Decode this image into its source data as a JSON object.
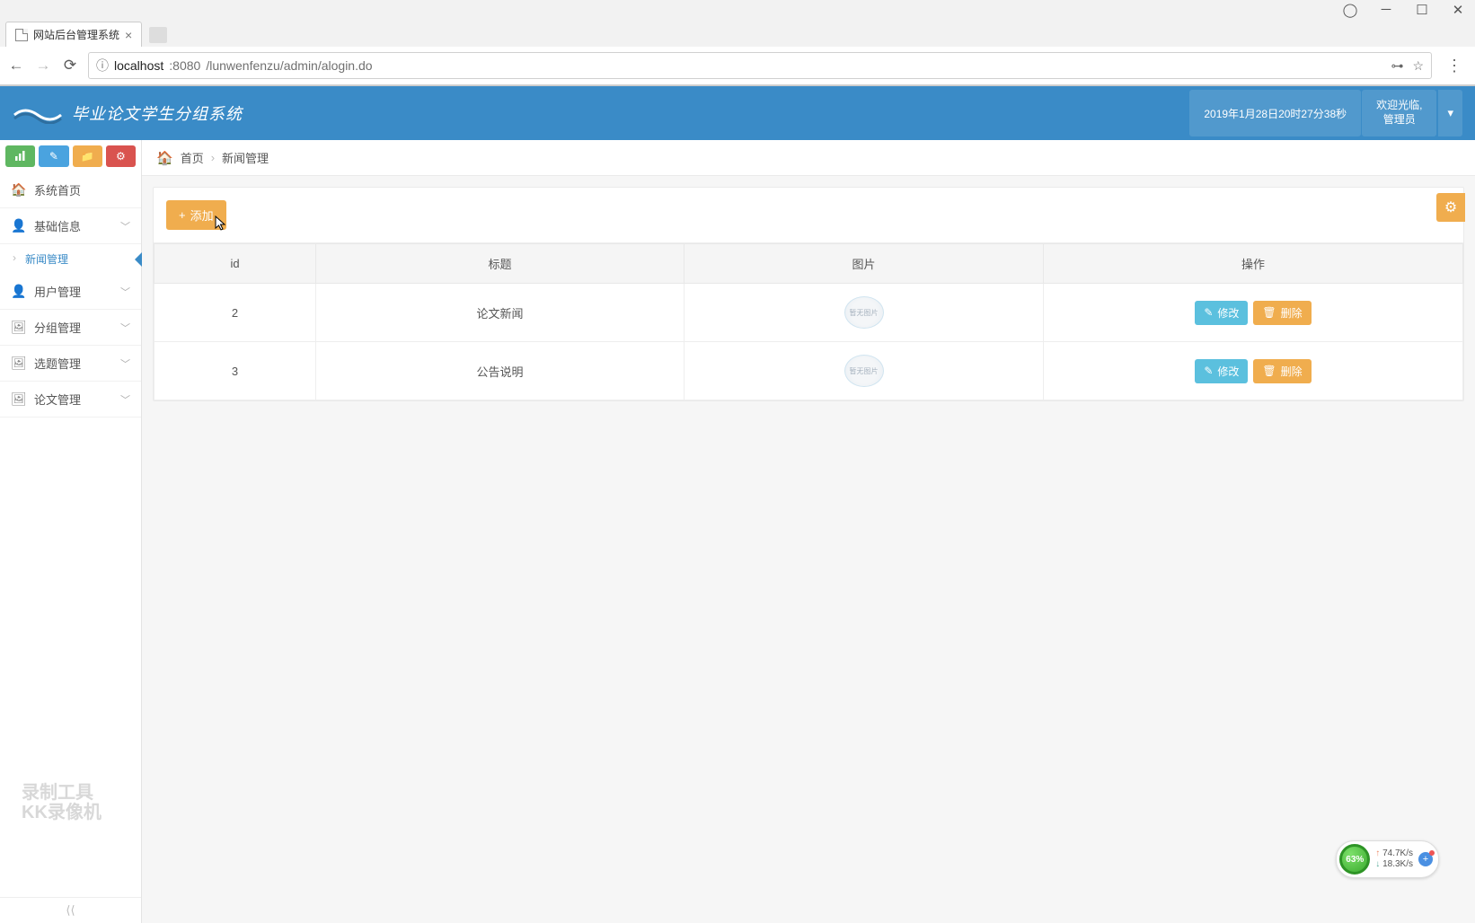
{
  "browser": {
    "tab_title": "网站后台管理系统",
    "url_host": "localhost",
    "url_port": ":8080",
    "url_path": "/lunwenfenzu/admin/alogin.do"
  },
  "header": {
    "brand_title": "毕业论文学生分组系统",
    "datetime": "2019年1月28日20时27分38秒",
    "welcome": "欢迎光临,",
    "role": "管理员"
  },
  "sidebar": {
    "items": [
      {
        "icon": "home-icon",
        "label": "系统首页",
        "expandable": false
      },
      {
        "icon": "user-icon",
        "label": "基础信息",
        "expandable": true,
        "expanded": true
      },
      {
        "icon": "user-icon",
        "label": "用户管理",
        "expandable": true
      },
      {
        "icon": "image-icon",
        "label": "分组管理",
        "expandable": true
      },
      {
        "icon": "image-icon",
        "label": "选题管理",
        "expandable": true
      },
      {
        "icon": "image-icon",
        "label": "论文管理",
        "expandable": true
      }
    ],
    "sub_active": "新闻管理"
  },
  "breadcrumb": {
    "home": "首页",
    "current": "新闻管理"
  },
  "toolbar": {
    "add_label": "添加"
  },
  "table": {
    "headers": {
      "id": "id",
      "title": "标题",
      "image": "图片",
      "actions": "操作"
    },
    "rows": [
      {
        "id": "2",
        "title": "论文新闻",
        "image_text": "暂无图片"
      },
      {
        "id": "3",
        "title": "公告说明",
        "image_text": "暂无图片"
      }
    ],
    "action_edit": "修改",
    "action_delete": "删除"
  },
  "watermark": {
    "line1": "录制工具",
    "line2": "KK录像机"
  },
  "netmeter": {
    "percent": "63%",
    "up": "74.7K/s",
    "down": "18.3K/s"
  }
}
